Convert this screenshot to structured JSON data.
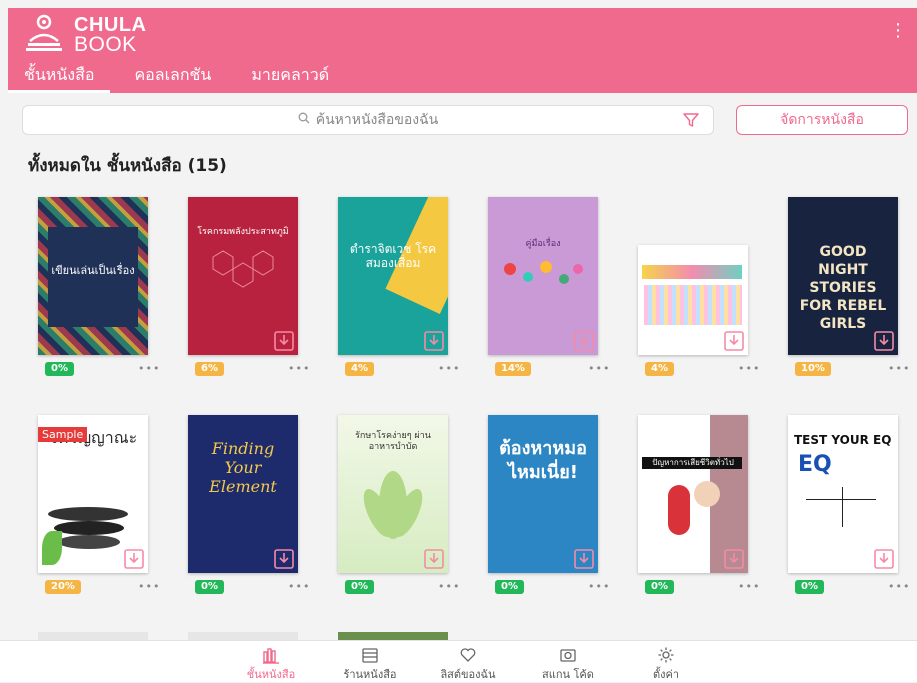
{
  "app": {
    "logo_line1": "CHULA",
    "logo_line2": "BOOK"
  },
  "tabs": [
    {
      "label": "ชั้นหนังสือ",
      "active": true
    },
    {
      "label": "คอลเลกชัน",
      "active": false
    },
    {
      "label": "มายคลาวด์",
      "active": false
    }
  ],
  "search": {
    "placeholder": "ค้นหาหนังสือของฉัน"
  },
  "manage_button": "จัดการหนังสือ",
  "section_title": "ทั้งหมดใน ชั้นหนังสือ (15)",
  "books": [
    {
      "title": "เขียนเล่นเป็นเรื่อง",
      "progress": "0%",
      "badge": "green",
      "sample": false
    },
    {
      "title": "โรคกรมพลังประสาทภูมิ",
      "progress": "6%",
      "badge": "orange",
      "sample": false
    },
    {
      "title": "ตำราจิตเวช โรคสมองเสื่อม",
      "progress": "4%",
      "badge": "orange",
      "sample": false
    },
    {
      "title": "คู่มือเรื่อง",
      "progress": "14%",
      "badge": "orange",
      "sample": false
    },
    {
      "title": "",
      "progress": "4%",
      "badge": "orange",
      "sample": false
    },
    {
      "title": "GOOD NIGHT STORIES FOR REBEL GIRLS",
      "progress": "10%",
      "badge": "orange",
      "sample": false
    },
    {
      "title": "จิตวิญญาณะ",
      "progress": "20%",
      "badge": "orange",
      "sample": true
    },
    {
      "title": "Finding Your Element",
      "progress": "0%",
      "badge": "green",
      "sample": false
    },
    {
      "title": "รักษาโรคง่ายๆ ผ่านอาหารบำบัด",
      "progress": "0%",
      "badge": "green",
      "sample": false
    },
    {
      "title": "ต้องหาหมอไหมเนี่ย!",
      "progress": "0%",
      "badge": "green",
      "sample": false
    },
    {
      "title": "ปัญหาการเสียชีวิตทั่วไป",
      "progress": "0%",
      "badge": "green",
      "sample": false
    },
    {
      "title": "TEST YOUR EQ",
      "progress": "0%",
      "badge": "green",
      "sample": false
    }
  ],
  "sample_label": "Sample",
  "more_dots": "•••",
  "bottom_nav": [
    {
      "label": "ชั้นหนังสือ",
      "icon": "bookshelf-icon",
      "active": true
    },
    {
      "label": "ร้านหนังสือ",
      "icon": "store-icon",
      "active": false
    },
    {
      "label": "ลิสต์ของฉัน",
      "icon": "heart-icon",
      "active": false
    },
    {
      "label": "สแกน โค้ด",
      "icon": "camera-icon",
      "active": false
    },
    {
      "label": "ตั้งค่า",
      "icon": "gear-icon",
      "active": false
    }
  ],
  "colors": {
    "brand": "#f06a8e",
    "progress_green": "#22b85a",
    "progress_orange": "#f5b545"
  }
}
